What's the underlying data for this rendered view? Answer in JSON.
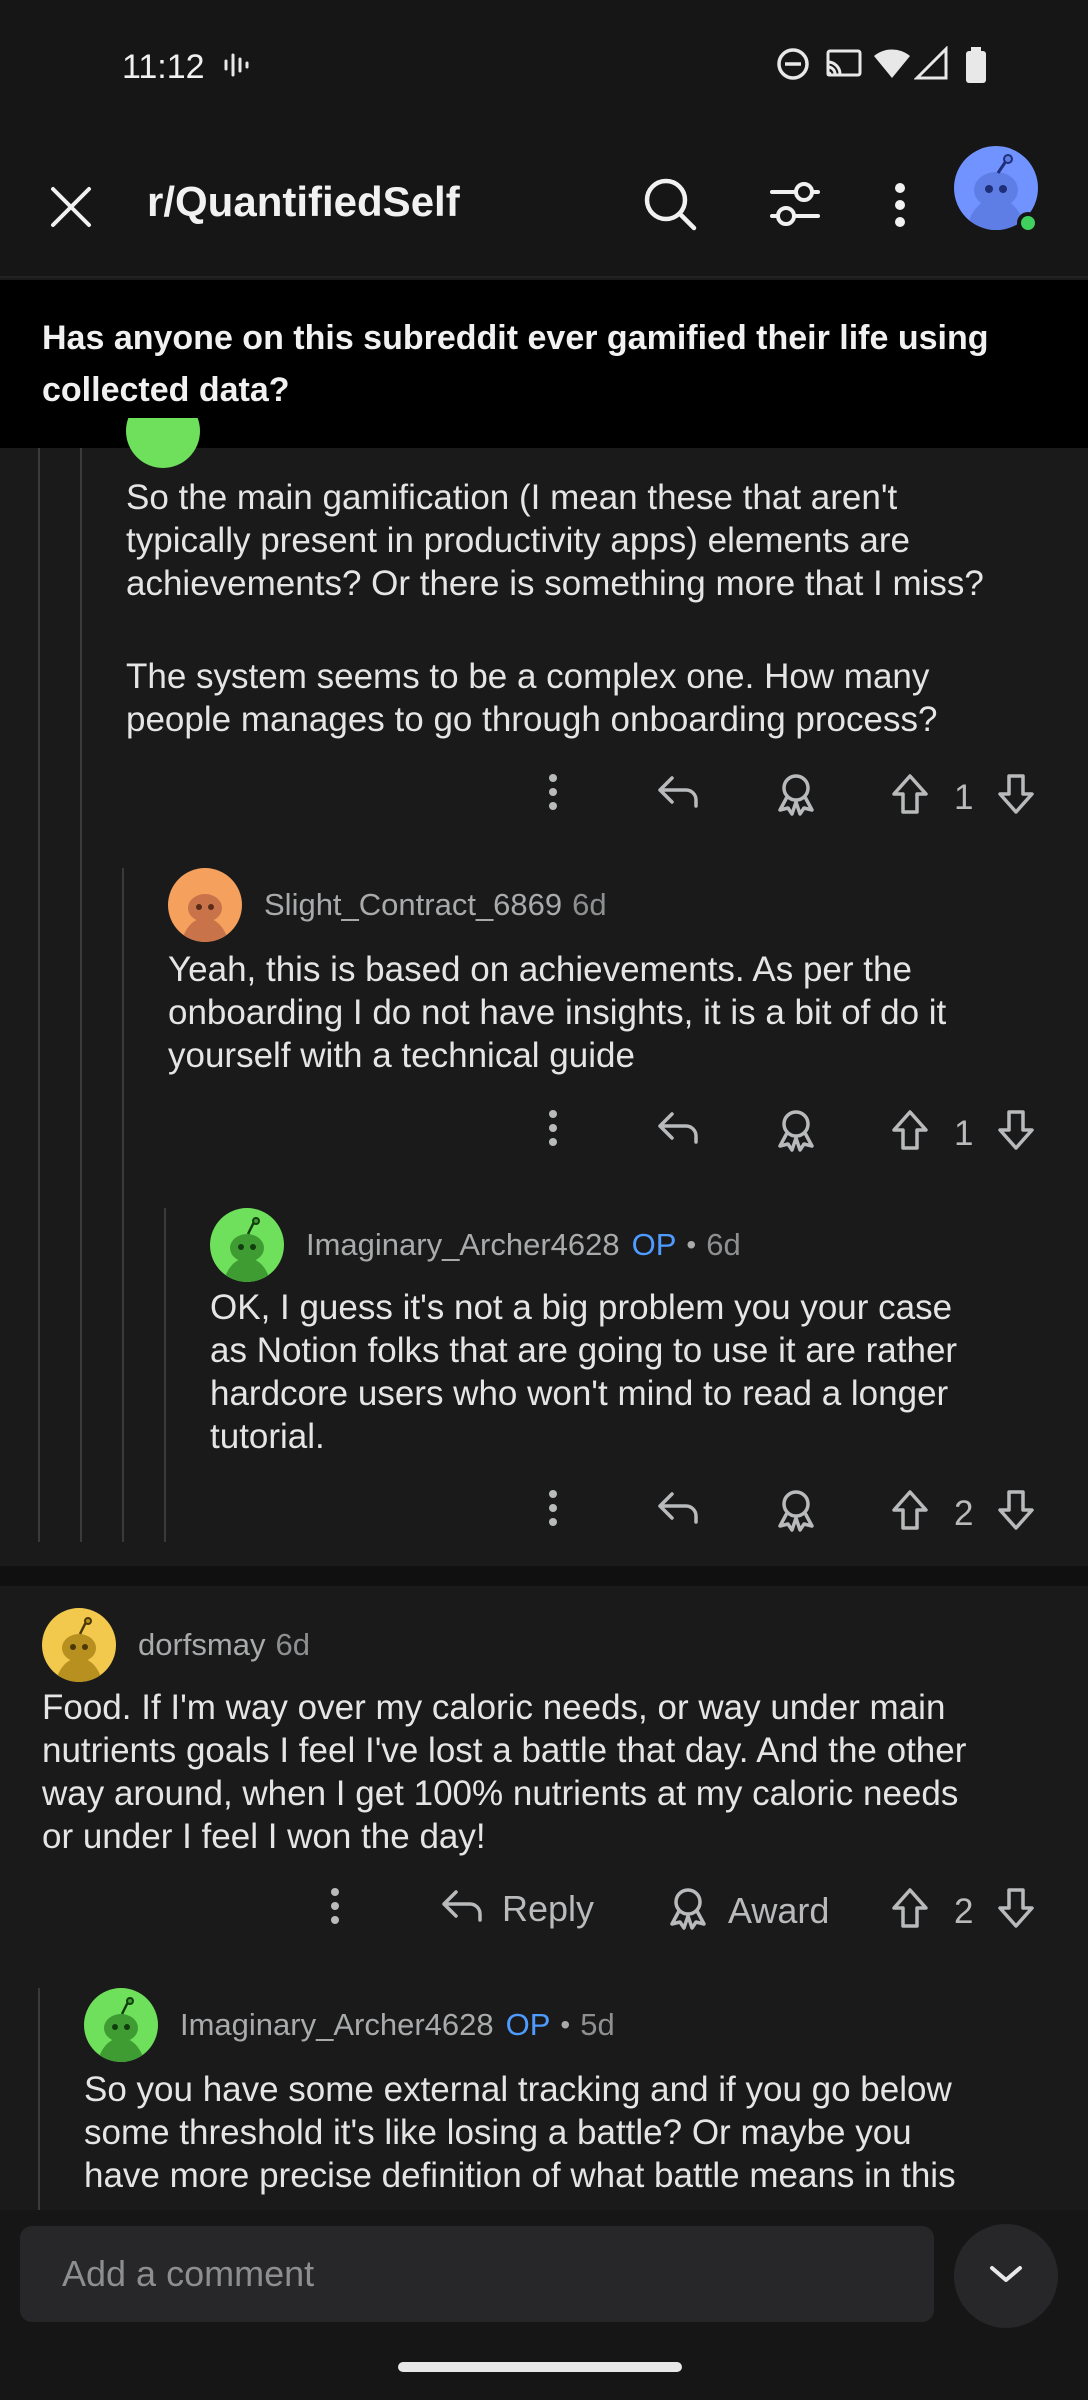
{
  "status": {
    "time": "11:12"
  },
  "header": {
    "subreddit": "r/QuantifiedSelf"
  },
  "post": {
    "title": "Has anyone on this subreddit ever gamified their life using collected data?"
  },
  "comments": [
    {
      "body_lines": [
        "So the main gamification (I mean these that aren't",
        "typically present in productivity apps) elements are",
        "achievements? Or there is something more that I miss?",
        "",
        "The system seems to be a complex one. How many",
        "people manages to go through onboarding process?"
      ],
      "votes": "1"
    },
    {
      "author": "Slight_Contract_6869",
      "age": "6d",
      "avatar_color": "#f5a05c",
      "body_lines": [
        "Yeah, this is based on achievements. As per the",
        "onboarding I do not have insights, it is a bit of do it",
        "yourself with a technical guide"
      ],
      "votes": "1"
    },
    {
      "author": "Imaginary_Archer4628",
      "op": "OP",
      "sep": "•",
      "age": "6d",
      "avatar_color": "#6ee05b",
      "body_lines": [
        "OK, I guess it's not a big problem you your case",
        "as Notion folks that are going to use it are rather",
        "hardcore users who won't mind to read a longer",
        "tutorial."
      ],
      "votes": "2"
    },
    {
      "author": "dorfsmay",
      "age": "6d",
      "avatar_color": "#f2c94c",
      "body_lines": [
        "Food. If I'm way over my caloric needs, or way under main",
        "nutrients goals I feel I've lost a battle that day. And the other",
        "way around, when I get 100% nutrients at my caloric needs",
        "or under I feel I won the day!"
      ],
      "votes": "2",
      "reply_label": "Reply",
      "award_label": "Award"
    },
    {
      "author": "Imaginary_Archer4628",
      "op": "OP",
      "sep": "•",
      "age": "5d",
      "avatar_color": "#6ee05b",
      "body_lines": [
        "So you have some external tracking and if you go below",
        "some threshold it's like losing a battle? Or maybe you",
        "have more precise definition of what battle means in this"
      ]
    }
  ],
  "composer": {
    "placeholder": "Add a comment"
  },
  "colors": {
    "background": "#1a1a1b",
    "op_accent": "#4f9bff",
    "online": "#3fd05d"
  }
}
